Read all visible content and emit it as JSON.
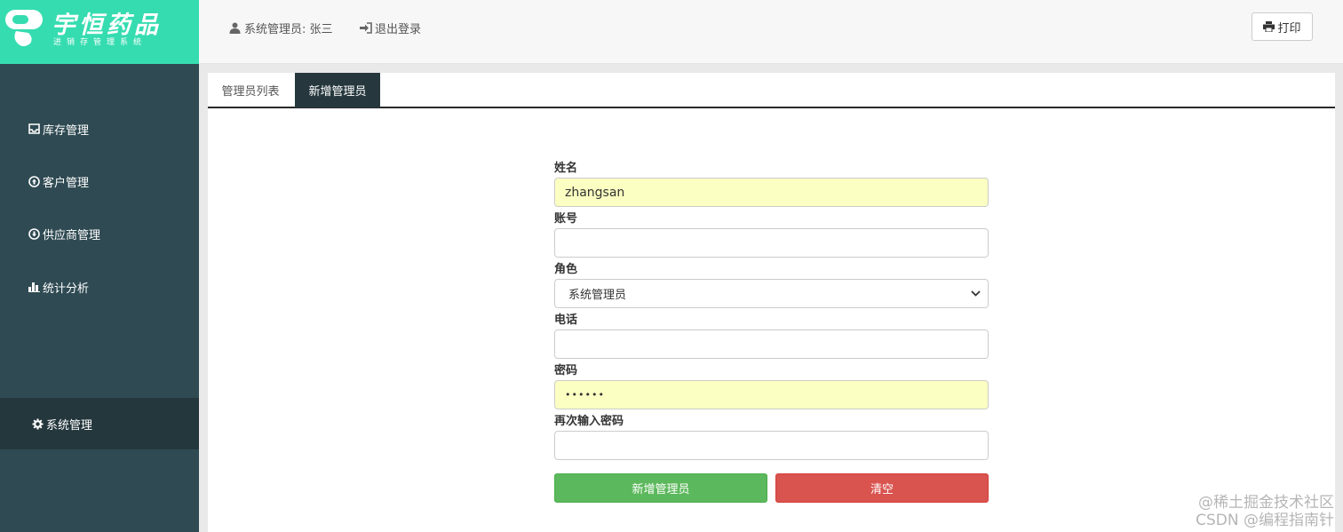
{
  "logo": {
    "title": "宇恒药品",
    "subtitle": "进销存管理系统"
  },
  "sidebar": {
    "items": [
      {
        "label": "库存管理",
        "icon": "inbox-icon"
      },
      {
        "label": "客户管理",
        "icon": "circle-up-icon"
      },
      {
        "label": "供应商管理",
        "icon": "circle-down-icon"
      },
      {
        "label": "统计分析",
        "icon": "bar-chart-icon"
      },
      {
        "label": "系统管理",
        "icon": "gear-icon",
        "active": true
      }
    ]
  },
  "header": {
    "user": "系统管理员: 张三",
    "logout": "退出登录",
    "print": "打印"
  },
  "tabs": [
    {
      "label": "管理员列表"
    },
    {
      "label": "新增管理员",
      "active": true
    }
  ],
  "form": {
    "name_label": "姓名",
    "name_value": "zhangsan",
    "account_label": "账号",
    "account_value": "",
    "role_label": "角色",
    "role_value": "系统管理员",
    "phone_label": "电话",
    "phone_value": "",
    "password_label": "密码",
    "password_value": "••••••",
    "confirm_label": "再次输入密码",
    "confirm_value": "",
    "submit": "新增管理员",
    "clear": "清空"
  },
  "watermark": {
    "line1": "@稀土掘金技术社区",
    "line2": "CSDN @编程指南针"
  },
  "colors": {
    "accent": "#35dcb0",
    "sidebar": "#2f4a52",
    "success": "#5cb85c",
    "danger": "#d9534f",
    "autofill": "#fbffc1"
  }
}
